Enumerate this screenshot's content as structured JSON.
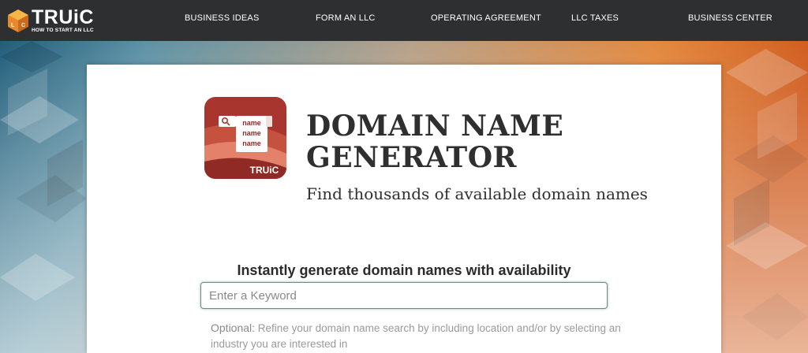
{
  "header": {
    "logo_text": "TRUiC",
    "logo_tagline": "HOW TO START AN LLC",
    "nav": [
      {
        "label": "BUSINESS IDEAS"
      },
      {
        "label": "FORM AN LLC"
      },
      {
        "label": "OPERATING AGREEMENT"
      },
      {
        "label": "LLC TAXES"
      },
      {
        "label": "BUSINESS CENTER"
      }
    ]
  },
  "hero": {
    "icon": {
      "name": "domain-name-generator-app-icon",
      "lines": [
        "name",
        "name",
        "name"
      ],
      "brand": "TRUiC"
    },
    "title": "DOMAIN NAME GENERATOR",
    "subtitle": "Find thousands of available domain names"
  },
  "form": {
    "heading": "Instantly generate domain names with availability",
    "keyword_placeholder": "Enter a Keyword",
    "keyword_value": "",
    "optional_lead": "Optional:",
    "optional_text": " Refine your domain name search by including location and/or by selecting an industry you are interested in"
  },
  "colors": {
    "header_bg": "#2d2f31",
    "logo_orange": "#f0922b",
    "icon_red": "#a8362e",
    "input_border": "#6f8b86"
  }
}
